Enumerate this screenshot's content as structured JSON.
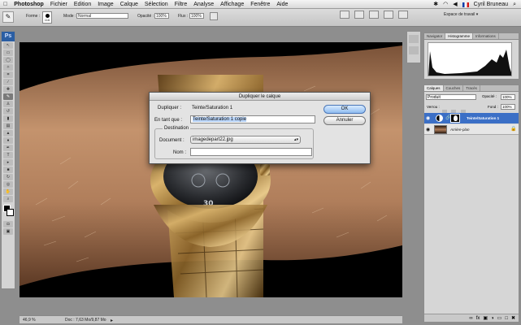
{
  "menubar": {
    "app": "Photoshop",
    "items": [
      "Fichier",
      "Edition",
      "Image",
      "Calque",
      "Sélection",
      "Filtre",
      "Analyse",
      "Affichage",
      "Fenêtre",
      "Aide"
    ],
    "user": "Cyril Bruneau"
  },
  "options": {
    "forme_label": "Forme :",
    "brush_size": "116",
    "mode_label": "Mode :",
    "mode_value": "Normal",
    "opacite_label": "Opacité :",
    "opacite_value": "100%",
    "flux_label": "Flux :",
    "flux_value": "100%",
    "workspace": "Espace de travail ▾"
  },
  "tools": {
    "ps_label": "Ps"
  },
  "status": {
    "zoom": "46,9 %",
    "doc": "Doc : 7,63 Mo/9,87 Mo"
  },
  "panels": {
    "top_tabs": [
      "Navigator",
      "Histogramme",
      "Informations"
    ],
    "layers_tabs": [
      "Calques",
      "Couches",
      "Tracés"
    ],
    "blend_mode": "Produit",
    "opacite_label": "Opacité :",
    "opacite_value": "100%",
    "verrou_label": "Verrou :",
    "fond_label": "Fond :",
    "fond_value": "100%",
    "layers": [
      {
        "name": "Teinte/Saturation 1",
        "selected": true
      },
      {
        "name": "Arrière-plan",
        "selected": false
      }
    ]
  },
  "dialog": {
    "title": "Dupliquer le calque",
    "dupliquer_label": "Dupliquer :",
    "dupliquer_value": "Teinte/Saturation 1",
    "en_tant_que_label": "En tant que :",
    "en_tant_que_value": "Teinte/Saturation 1 copie",
    "destination_label": "Destination",
    "document_label": "Document :",
    "document_value": "imagedepart22.jpg",
    "nom_label": "Nom :",
    "nom_value": "",
    "ok_label": "OK",
    "cancel_label": "Annuler"
  }
}
